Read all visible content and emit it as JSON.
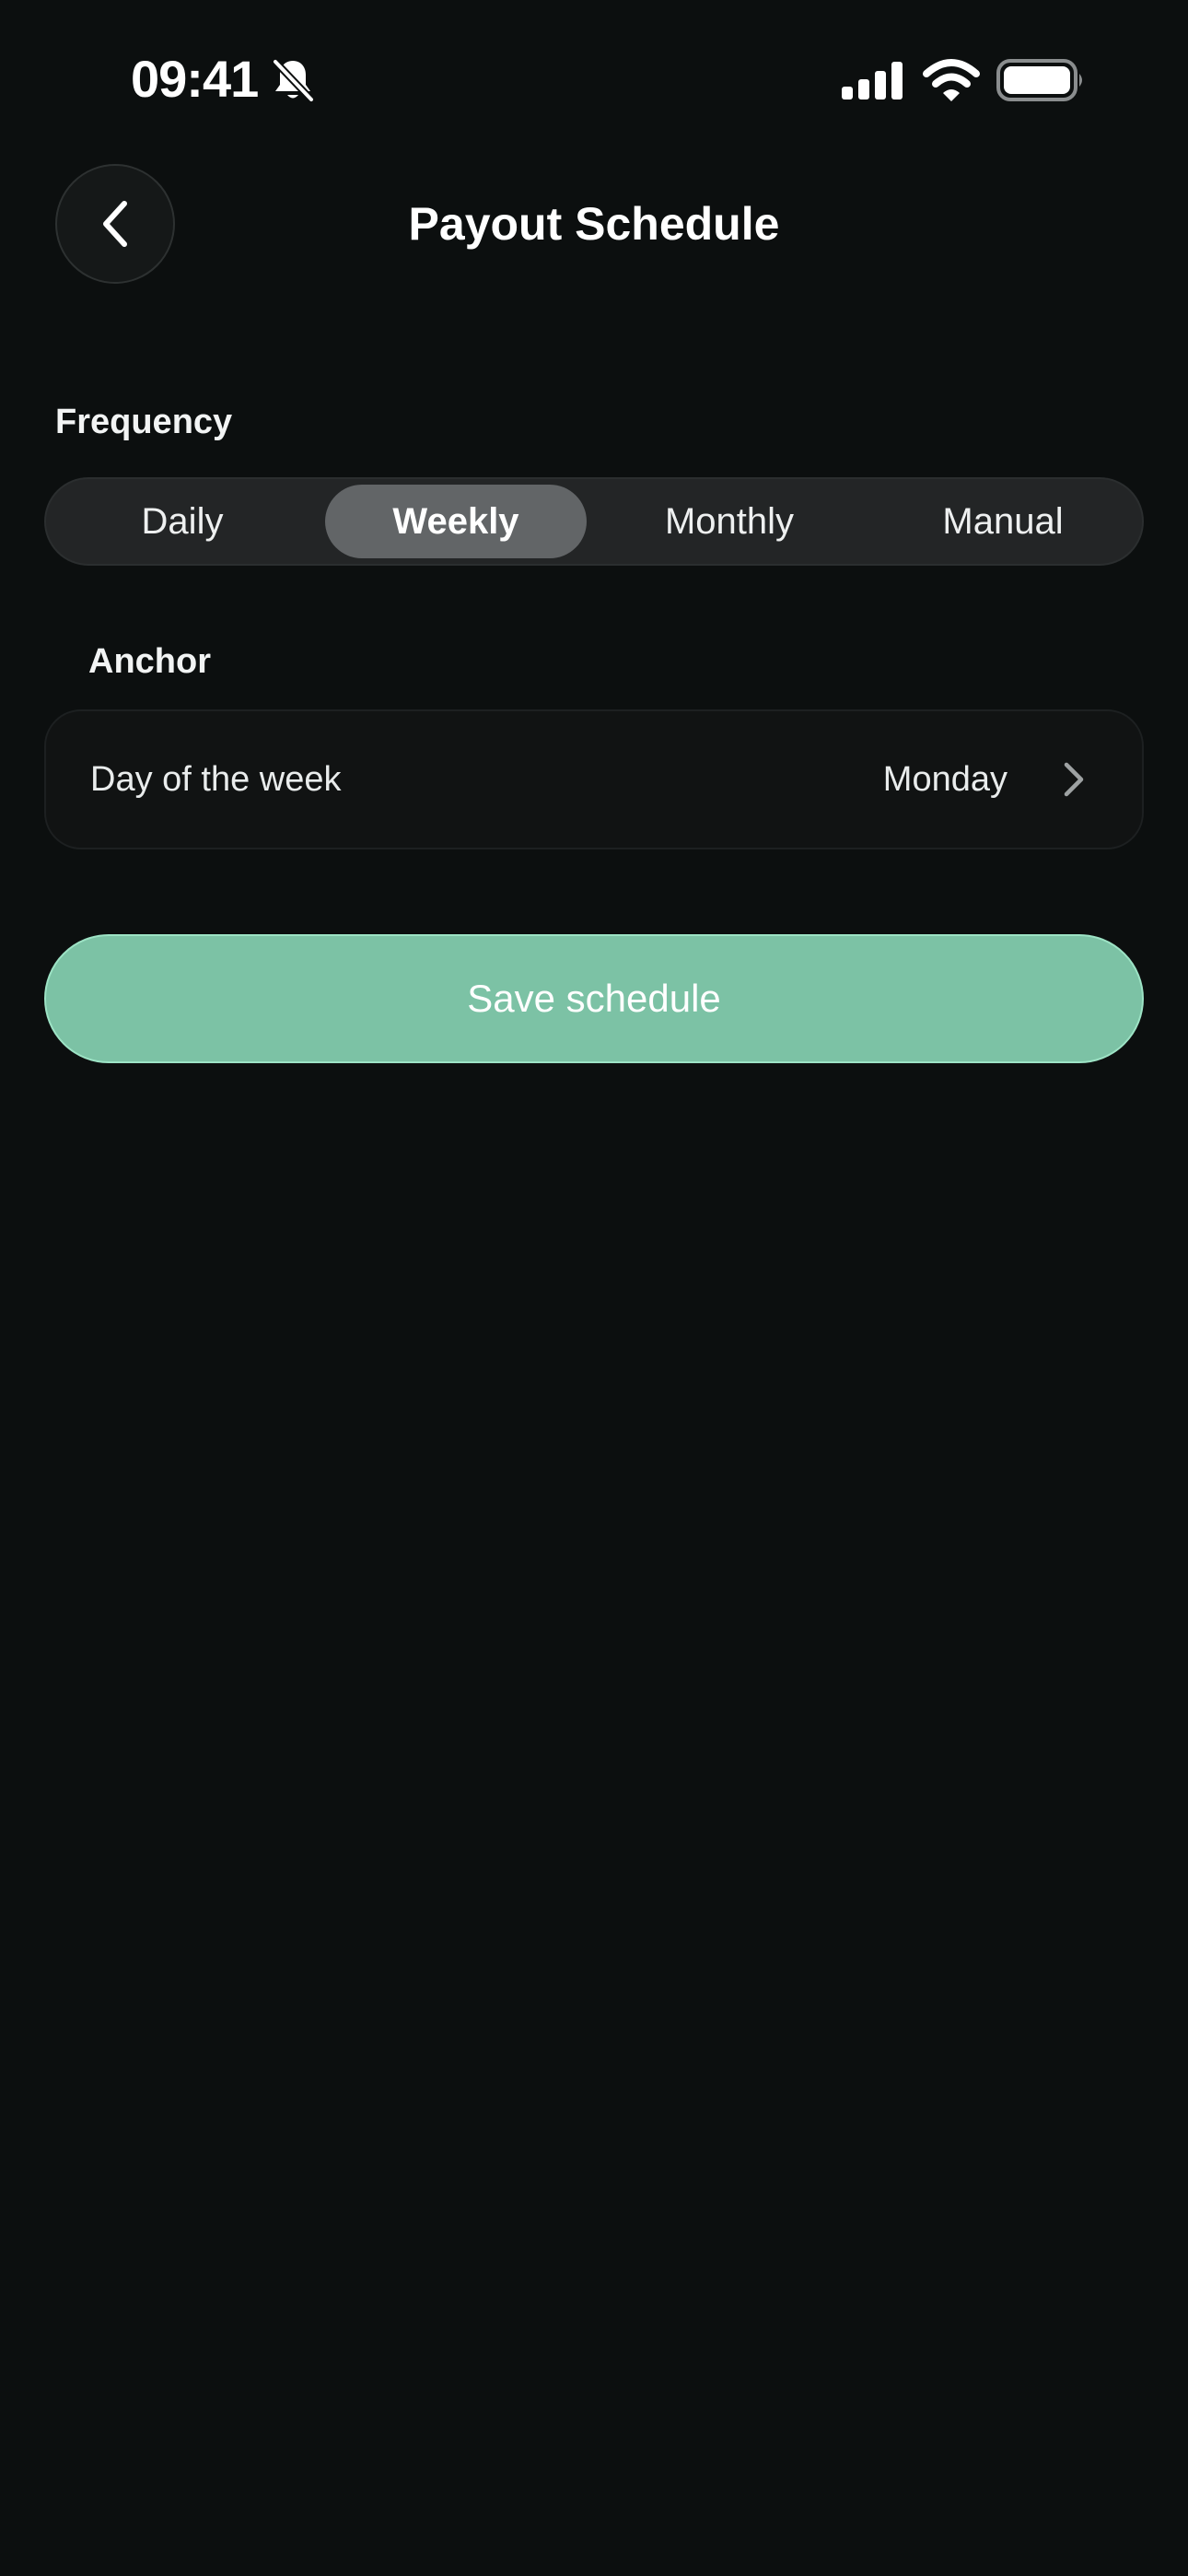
{
  "status_bar": {
    "time": "09:41",
    "icons": [
      "bell-slash-icon",
      "cellular-signal-icon",
      "wifi-icon",
      "battery-icon"
    ]
  },
  "header": {
    "back_icon": "chevron-left-icon",
    "title": "Payout Schedule"
  },
  "frequency": {
    "label": "Frequency",
    "options": [
      "Daily",
      "Weekly",
      "Monthly",
      "Manual"
    ],
    "selected": "Weekly"
  },
  "anchor": {
    "label": "Anchor",
    "row_label": "Day of the week",
    "row_value": "Monday",
    "row_icon": "chevron-right-icon"
  },
  "actions": {
    "save_label": "Save schedule"
  },
  "colors": {
    "background": "#0c0f0f",
    "accent": "#7cc2a5",
    "segment_selected": "#626567"
  }
}
